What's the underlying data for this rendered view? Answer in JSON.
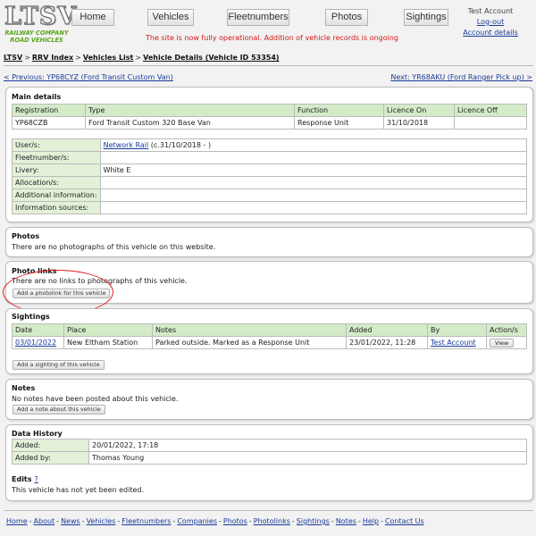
{
  "logo": {
    "text": "LTSV",
    "sub1": "RAILWAY COMPANY",
    "sub2": "ROAD VEHICLES"
  },
  "nav": [
    "Home",
    "Vehicles",
    "Fleetnumbers",
    "Photos",
    "Sightings"
  ],
  "status_message": "The site is now fully operational. Addition of vehicle records is ongoing",
  "account": {
    "name": "Test Account",
    "logout": "Log-out",
    "details": "Account details"
  },
  "breadcrumb": [
    "LTSV",
    "RRV Index",
    "Vehicles List",
    "Vehicle Details (Vehicle ID 53354)"
  ],
  "breadcrumb_sep": ">",
  "prev_link": "< Previous: YP68CYZ (Ford Transit Custom Van)",
  "next_link": "Next: YR68AKU (Ford Ranger Pick up) >",
  "main": {
    "title": "Main details",
    "headers": [
      "Registration",
      "Type",
      "Function",
      "Licence On",
      "Licence Off"
    ],
    "row": [
      "YP68CZB",
      "Ford Transit Custom 320 Base Van",
      "Response Unit",
      "31/10/2018",
      ""
    ],
    "users_label": "User/s:",
    "users_link": "Network Rail",
    "users_extra": " (c.31/10/2018 - )",
    "fleet_label": "Fleetnumber/s:",
    "fleet_value": "",
    "livery_label": "Livery:",
    "livery_value": "White E",
    "alloc_label": "Allocation/s:",
    "alloc_value": "",
    "addinfo_label": "Additional information:",
    "addinfo_value": "",
    "sources_label": "Information sources:",
    "sources_value": ""
  },
  "photos": {
    "title": "Photos",
    "text": "There are no photographs of this vehicle on this website."
  },
  "photo_links": {
    "title": "Photo links",
    "text": "There are no links to photographs of this vehicle.",
    "button": "Add a photolink for this vehicle"
  },
  "sightings": {
    "title": "Sightings",
    "headers": [
      "Date",
      "Place",
      "Notes",
      "Added",
      "By",
      "Action/s"
    ],
    "rows": [
      {
        "date": "03/01/2022",
        "place": "New Eltham Station",
        "notes": "Parked outside. Marked as a Response Unit",
        "added": "23/01/2022, 11:28",
        "by": "Test Account",
        "action": "View"
      }
    ],
    "button": "Add a sighting of this vehicle"
  },
  "notes": {
    "title": "Notes",
    "text": "No notes have been posted about this vehicle.",
    "button": "Add a note about this vehicle"
  },
  "history": {
    "title": "Data History",
    "added_label": "Added:",
    "added_value": "20/01/2022, 17:18",
    "addedby_label": "Added by:",
    "addedby_value": "Thomas Young",
    "edits_title": "Edits",
    "edits_help": "?",
    "edits_text": "This vehicle has not yet been edited."
  },
  "footer": [
    "Home",
    "About",
    "News",
    "Vehicles",
    "Fleetnumbers",
    "Companies",
    "Photos",
    "Photolinks",
    "Sightings",
    "Notes",
    "Help",
    "Contact Us"
  ],
  "footer_sep": "-",
  "colors": {
    "header_cell": "#d4ebc8",
    "label_cell": "#e2f1d8",
    "link": "#1a3a9a",
    "status": "#d41818",
    "logo_green": "#5aa51e",
    "annotation": "#e02020"
  }
}
